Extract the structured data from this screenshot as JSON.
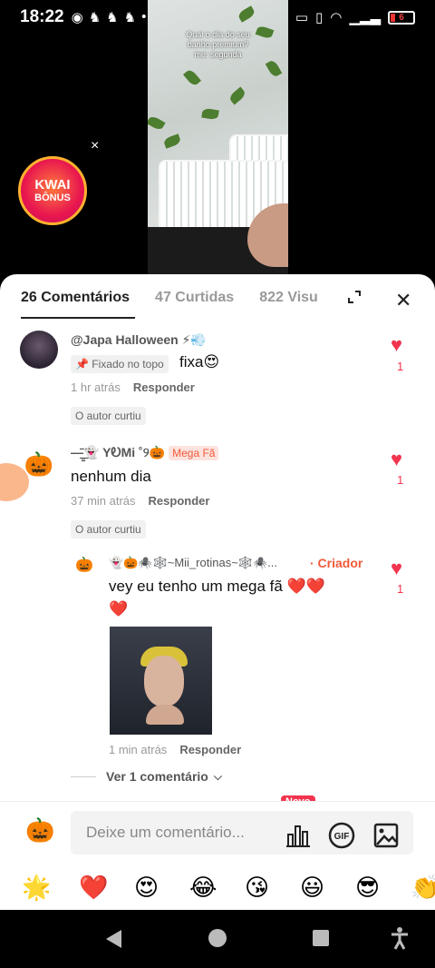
{
  "statusbar": {
    "time": "18:22",
    "battery": "6"
  },
  "video": {
    "caption_lines": [
      "Qual o dia do seu",
      "banho premium?",
      "me: segunda"
    ]
  },
  "promo": {
    "title": "KWAI",
    "subtitle": "BÔNUS",
    "close": "×"
  },
  "tabs": {
    "comments": "26 Comentários",
    "likes": "47 Curtidas",
    "views": "822 Visu"
  },
  "comments": [
    {
      "username": "@Japa Halloween ⚡💨",
      "pinned_label": "📌 Fixado no topo",
      "text": "fixa😍",
      "time": "1 hr atrás",
      "reply": "Responder",
      "author_liked": "O autor curtiu",
      "likes": "1"
    },
    {
      "username": "—̳͟͞͞👻 YᎧMi ˚୨🎃",
      "badge": "Mega Fã",
      "text": "nenhum dia",
      "time": "37 min atrás",
      "reply": "Responder",
      "author_liked": "O autor curtiu",
      "likes": "1"
    },
    {
      "username": "👻🎃🕷️🕸️~Mii_rotinas~🕸️🕷️...",
      "creator_label": "· Criador",
      "text_line1": "vey eu tenho um mega fã ❤️❤️",
      "text_line2": "❤️",
      "time": "1 min atrás",
      "reply": "Responder",
      "likes": "1"
    }
  ],
  "view_more": "Ver 1 comentário",
  "input": {
    "placeholder": "Deixe um comentário...",
    "new_badge": "Novo"
  },
  "quick_emojis": [
    "🌟",
    "❤️",
    "😍",
    "😂",
    "😘",
    "😃",
    "😎",
    "👏"
  ],
  "colors": {
    "accent": "#f2344f",
    "creator": "#f05a3a"
  }
}
